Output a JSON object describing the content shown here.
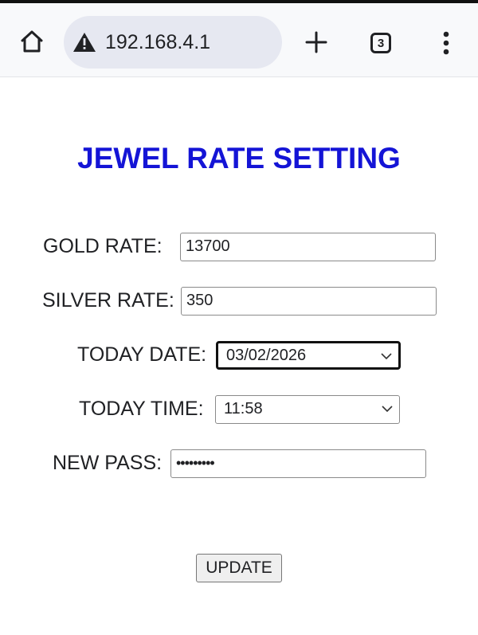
{
  "browser": {
    "url": "192.168.4.1",
    "tab_count": "3"
  },
  "page": {
    "title": "JEWEL RATE SETTING"
  },
  "form": {
    "gold_rate": {
      "label": "GOLD RATE:",
      "value": "13700"
    },
    "silver_rate": {
      "label": "SILVER RATE:",
      "value": "350"
    },
    "today_date": {
      "label": "TODAY DATE:",
      "value": "03/02/2026"
    },
    "today_time": {
      "label": "TODAY TIME:",
      "value": "11:58"
    },
    "new_pass": {
      "label": "NEW PASS:",
      "value": "•••••••••"
    },
    "update_label": "UPDATE"
  },
  "colors": {
    "title": "#1414d6",
    "browser_bar": "#f8f9fb",
    "url_pill": "#e6e8f1"
  },
  "icons": {
    "home": "home-icon",
    "warning": "warning-icon",
    "new_tab": "plus-icon",
    "tabs": "tab-switcher-icon",
    "menu": "more-vert-icon",
    "dropdown": "chevron-down-icon"
  }
}
